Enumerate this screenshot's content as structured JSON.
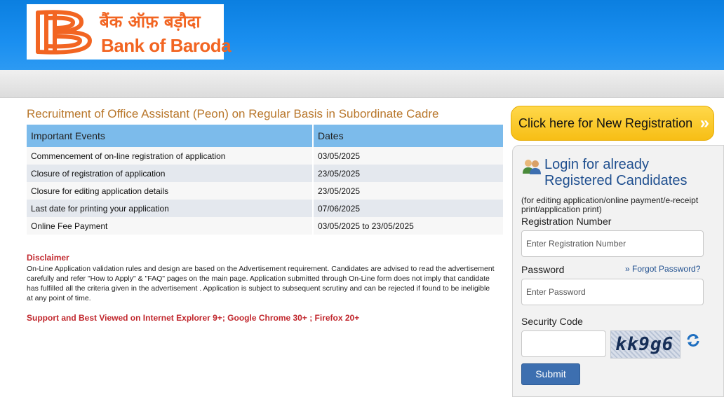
{
  "brand": {
    "hindi_name": "बैंक ऑफ़ बड़ौदा",
    "english_name": "Bank of Baroda",
    "accent_color": "#f26522"
  },
  "page_title": "Recruitment of Office Assistant (Peon) on Regular Basis in Subordinate Cadre",
  "events_table": {
    "headers": [
      "Important Events",
      "Dates"
    ],
    "rows": [
      [
        "Commencement of on-line registration of application",
        "03/05/2025"
      ],
      [
        "Closure of registration of application",
        "23/05/2025"
      ],
      [
        "Closure for editing application details",
        "23/05/2025"
      ],
      [
        "Last date for printing your application",
        "07/06/2025"
      ],
      [
        "Online Fee Payment",
        "03/05/2025 to 23/05/2025"
      ]
    ]
  },
  "disclaimer": {
    "title": "Disclaimer",
    "text": "On-Line Application validation rules and design are based on the Advertisement requirement. Candidates are advised to read the advertisement carefully and refer \"How to Apply\" & \"FAQ\" pages on the main page. Application submitted through On-Line form does not imply that candidate has fulfilled all the criteria given in the advertisement . Application is subject to subsequent scrutiny and can be rejected if found to be ineligible at any point of time."
  },
  "support_text": "Support and Best Viewed on Internet Explorer 9+; Google Chrome 30+ ; Firefox 20+",
  "new_registration": {
    "label": "Click here for New Registration",
    "arrow": "»"
  },
  "login": {
    "title": "Login for already Registered Candidates",
    "note": "(for editing application/online payment/e-receipt print/application print)",
    "registration_label": "Registration Number",
    "registration_placeholder": "Enter Registration Number",
    "password_label": "Password",
    "password_placeholder": "Enter Password",
    "forgot_label": "Forgot Password?",
    "forgot_prefix": "»",
    "security_label": "Security Code",
    "captcha_text": "kk9g6",
    "submit_label": "Submit"
  }
}
